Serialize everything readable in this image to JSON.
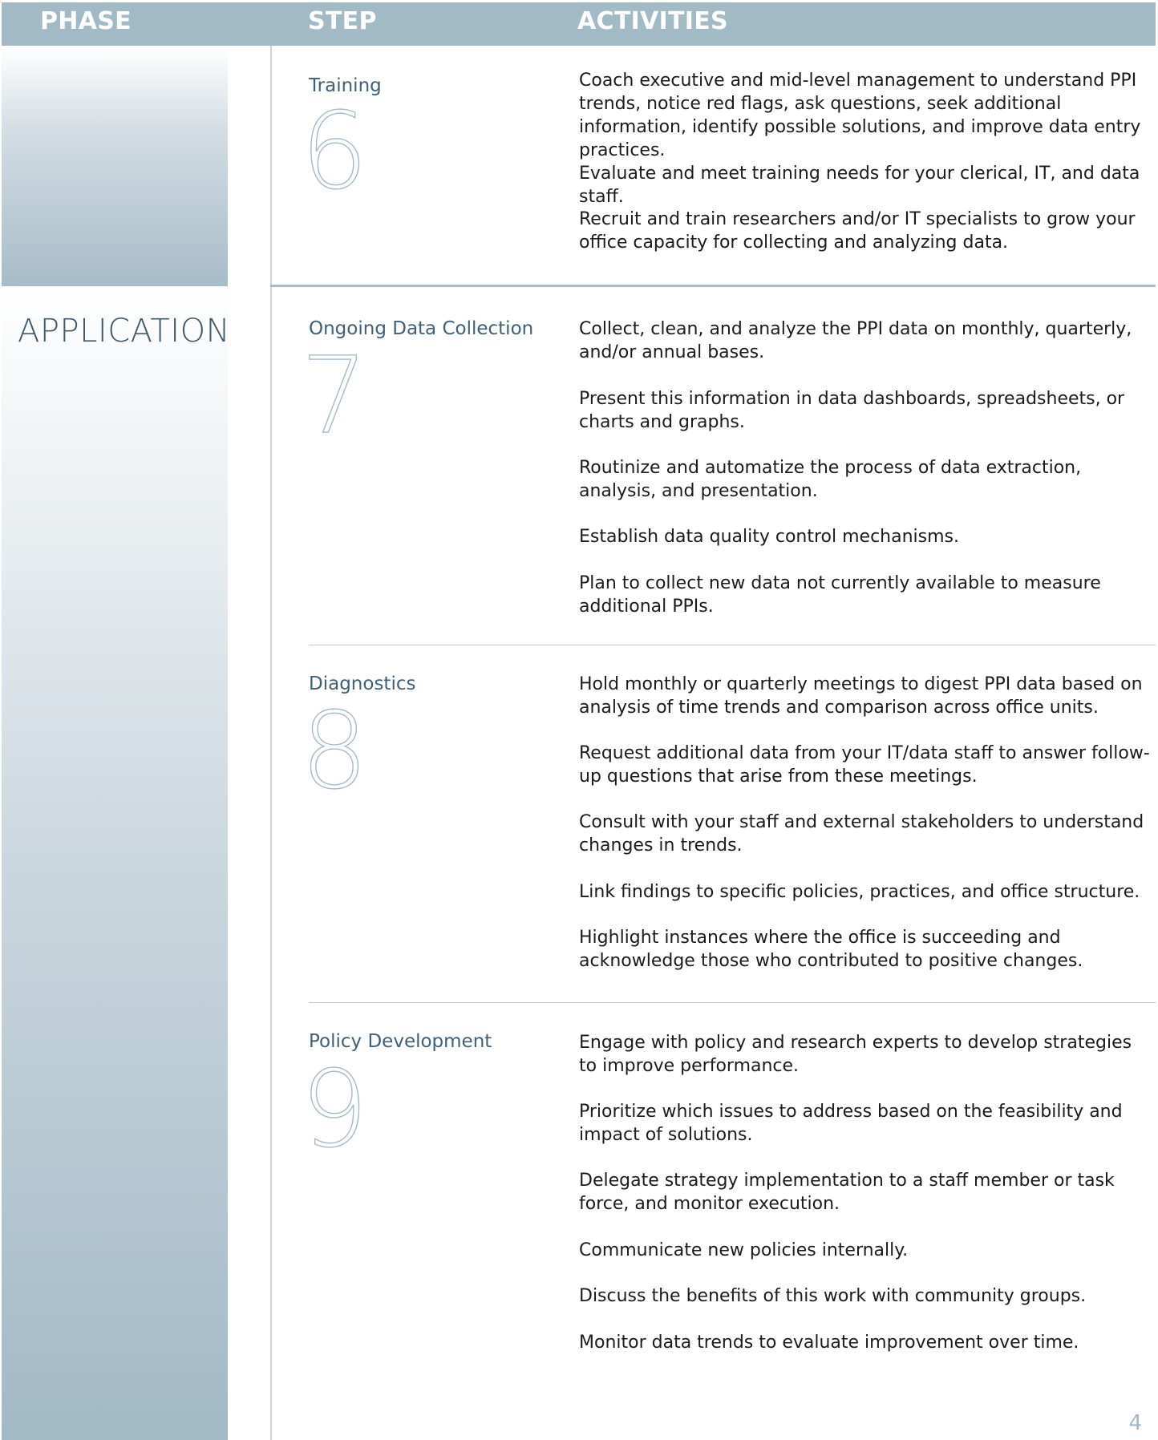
{
  "header": {
    "phase": "PHASE",
    "step": "STEP",
    "activities": "ACTIVITIES"
  },
  "phase": {
    "name": "APPLICATION"
  },
  "steps": [
    {
      "title": "Training",
      "number": "6",
      "activities": [
        "Coach executive and mid-level management to understand PPI trends, notice red flags, ask questions, seek additional information, identify possible solutions, and improve data entry practices.",
        "Evaluate and meet training needs for your clerical, IT, and data staff.",
        "Recruit and train researchers and/or IT specialists to grow your office capacity for collecting and analyzing data."
      ]
    },
    {
      "title": "Ongoing Data Collection",
      "number": "7",
      "activities": [
        "Collect, clean, and analyze the PPI data on monthly, quarterly, and/or annual bases.",
        "Present this information in data dashboards, spreadsheets, or charts and graphs.",
        "Routinize and automatize the process of data extraction, analysis, and presentation.",
        "Establish data quality control mechanisms.",
        "Plan to collect new data not currently available to measure additional PPIs."
      ]
    },
    {
      "title": "Diagnostics",
      "number": "8",
      "activities": [
        "Hold monthly or quarterly meetings to digest PPI data based on analysis of time trends and comparison across office units.",
        "Request additional data from your IT/data staff to answer follow-up questions that arise from these meetings.",
        "Consult with your staff and external stakeholders to understand changes in trends.",
        "Link findings to specific policies, practices, and office structure.",
        "Highlight instances where the office is succeeding and acknowledge those who contributed to positive changes."
      ]
    },
    {
      "title": "Policy Development",
      "number": "9",
      "activities": [
        "Engage with policy and research experts to develop strategies to improve performance.",
        "Prioritize which issues to address based on the feasibility and impact of solutions.",
        "Delegate strategy implementation to a staff member or task force, and monitor execution.",
        "Communicate new policies internally.",
        "Discuss the benefits of this work with community groups.",
        "Monitor data trends to evaluate improvement over time."
      ]
    }
  ],
  "page_number": "4"
}
